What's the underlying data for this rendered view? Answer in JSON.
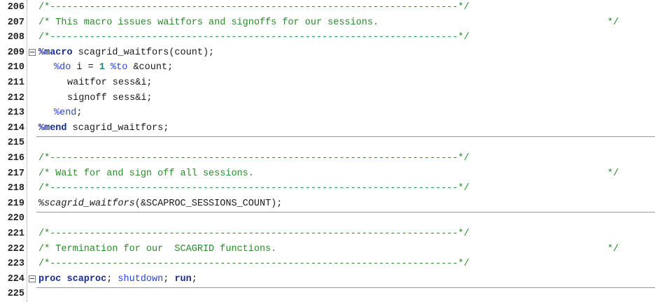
{
  "lines": [
    {
      "num": "206",
      "text": "/*------------------------------------------------------------------------*/"
    },
    {
      "num": "207",
      "a": "/* This macro issues waitfors and signoffs for our sessions.",
      "b": "*/"
    },
    {
      "num": "208",
      "text": "/*------------------------------------------------------------------------*/"
    },
    {
      "num": "209",
      "kw": "%macro",
      "rest": " scagrid_waitfors(count);"
    },
    {
      "num": "210",
      "mac1": "%do",
      "t1": " i = ",
      "n": "1",
      "t2": " ",
      "mac2": "%to",
      "t3": " &count;"
    },
    {
      "num": "211",
      "text": "waitfor sess&i;"
    },
    {
      "num": "212",
      "text": "signoff sess&i;"
    },
    {
      "num": "213",
      "mac": "%end",
      "rest": ";"
    },
    {
      "num": "214",
      "kw": "%mend",
      "rest": " scagrid_waitfors;"
    },
    {
      "num": "215"
    },
    {
      "num": "216",
      "text": "/*------------------------------------------------------------------------*/"
    },
    {
      "num": "217",
      "a": "/* Wait for and sign off all sessions.",
      "b": "*/"
    },
    {
      "num": "218",
      "text": "/*------------------------------------------------------------------------*/"
    },
    {
      "num": "219",
      "pct": "%",
      "ital": "scagrid_waitfors",
      "rest": "(&SCAPROC_SESSIONS_COUNT);"
    },
    {
      "num": "220"
    },
    {
      "num": "221",
      "text": "/*------------------------------------------------------------------------*/"
    },
    {
      "num": "222",
      "a": "/* Termination for our  SCAGRID functions.",
      "b": "*/"
    },
    {
      "num": "223",
      "text": "/*------------------------------------------------------------------------*/"
    },
    {
      "num": "224",
      "kw": "proc scaproc",
      "t1": "; ",
      "mac": "shutdown",
      "t2": "; ",
      "kw2": "run",
      "t3": ";"
    },
    {
      "num": "225"
    }
  ]
}
